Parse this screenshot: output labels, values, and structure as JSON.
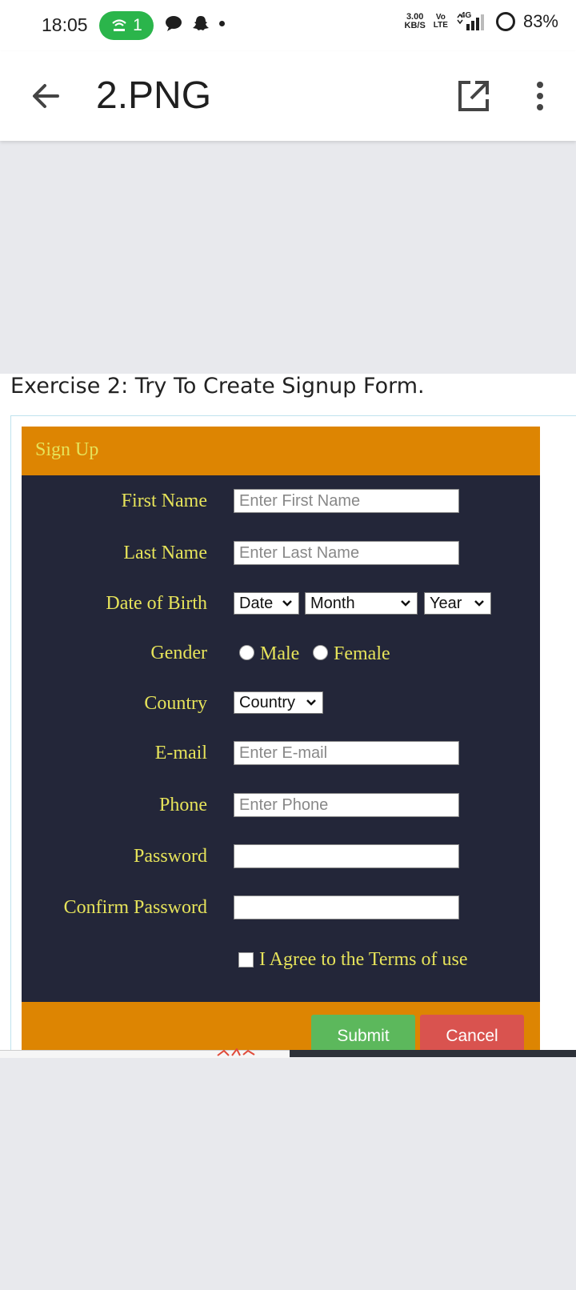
{
  "status_bar": {
    "time": "18:05",
    "hotspot_count": "1",
    "speed_value": "3.00",
    "speed_unit": "KB/S",
    "volte_top": "Vo",
    "volte_bottom": "LTE",
    "network": "4G",
    "battery": "83%"
  },
  "app_bar": {
    "title": "2.PNG",
    "back_icon": "arrow-back-icon",
    "open_icon": "open-external-icon",
    "more_icon": "more-vertical-icon"
  },
  "doc": {
    "exercise_title": "Exercise 2: Try To Create Signup Form.",
    "form": {
      "header_title": "Sign Up",
      "first_name_label": "First Name",
      "first_name_placeholder": "Enter First Name",
      "last_name_label": "Last Name",
      "last_name_placeholder": "Enter Last Name",
      "dob_label": "Date of Birth",
      "dob_date": "Date",
      "dob_month": "Month",
      "dob_year": "Year",
      "gender_label": "Gender",
      "gender_male": "Male",
      "gender_female": "Female",
      "country_label": "Country",
      "country_value": "Country",
      "email_label": "E-mail",
      "email_placeholder": "Enter E-mail",
      "phone_label": "Phone",
      "phone_placeholder": "Enter Phone",
      "password_label": "Password",
      "password_value": "",
      "confirm_password_label": "Confirm Password",
      "confirm_password_value": "",
      "terms_label": "I Agree to the Terms of use",
      "submit_label": "Submit",
      "cancel_label": "Cancel"
    }
  },
  "colors": {
    "form_bg": "#232639",
    "accent_orange": "#dd8502",
    "label_yellow": "#e6e35a",
    "submit_green": "#5cb85c",
    "cancel_red": "#d9534f"
  }
}
